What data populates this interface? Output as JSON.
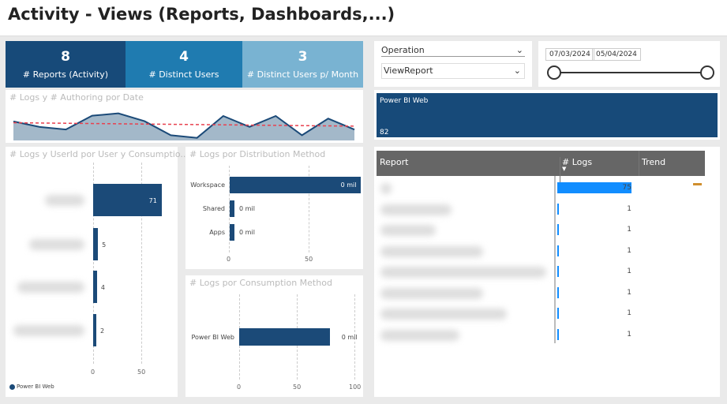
{
  "title": "Activity - Views (Reports, Dashboards,...)",
  "kpis": [
    {
      "value": "8",
      "label": "# Reports (Activity)",
      "color": "#174a79"
    },
    {
      "value": "4",
      "label": "# Distinct Users",
      "color": "#1f7bb0"
    },
    {
      "value": "3",
      "label": "# Distinct Users p/ Month",
      "color": "#79b3d2"
    }
  ],
  "filters": {
    "operation_label": "Operation",
    "operation_value": "ViewReport",
    "date_start": "07/03/2024",
    "date_end": "05/04/2024"
  },
  "card": {
    "label": "Power BI Web",
    "value": "82"
  },
  "chart_data": [
    {
      "type": "area",
      "title": "# Logs y # Authoring por Date",
      "values": [
        73,
        52,
        42,
        95,
        104,
        74,
        20,
        10,
        94,
        52,
        94,
        20,
        84,
        42
      ],
      "trend": [
        68,
        55
      ],
      "colors": {
        "area": "#a3b8c9",
        "line": "#1b4a78",
        "trend": "#e8414f"
      }
    },
    {
      "type": "bar",
      "title": "# Logs y UserId por User y Consumptio...",
      "values": [
        71,
        5,
        4,
        2
      ],
      "data_labels": [
        "71",
        "5",
        "4",
        "2"
      ],
      "ticks": [
        "0",
        "50"
      ],
      "xlim": [
        0,
        80
      ],
      "legend": "Power BI Web"
    },
    {
      "type": "bar",
      "title": "# Logs por Distribution Method",
      "categories": [
        "Workspace",
        "Shared",
        "Apps"
      ],
      "values": [
        82,
        3,
        3
      ],
      "data_labels": [
        "0 mil",
        "0 mil",
        "0 mil"
      ],
      "ticks": [
        "0",
        "50"
      ],
      "xlim": [
        0,
        90
      ]
    },
    {
      "type": "bar",
      "title": "# Logs por Consumption Method",
      "categories": [
        "Power BI Web"
      ],
      "values": [
        82
      ],
      "data_labels": [
        "0 mil"
      ],
      "ticks": [
        "0",
        "50",
        "100"
      ],
      "xlim": [
        0,
        100
      ]
    }
  ],
  "table": {
    "headers": [
      "Report",
      "# Logs",
      "Trend"
    ],
    "logs": [
      75,
      1,
      1,
      1,
      1,
      1,
      1,
      1
    ]
  }
}
